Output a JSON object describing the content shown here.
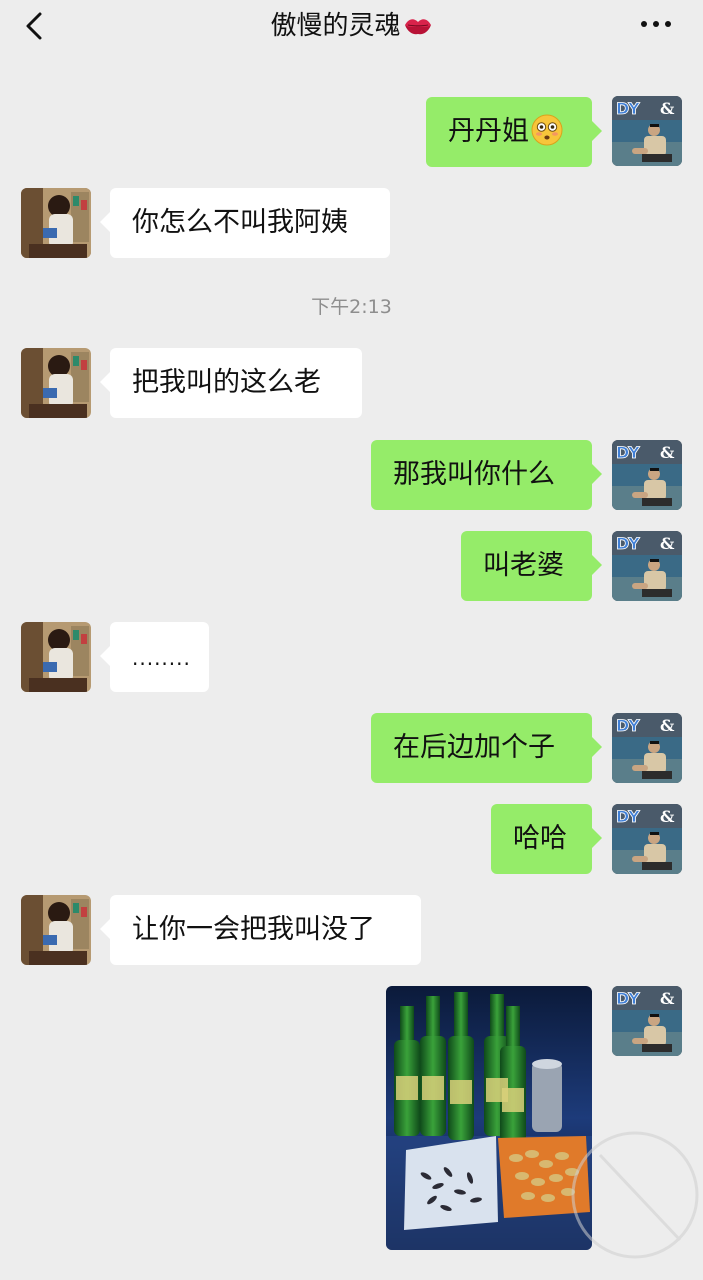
{
  "header": {
    "title": "傲慢的灵魂",
    "title_emoji": "lips-icon",
    "back_icon": "chevron-left-icon",
    "more_icon": "ellipsis-icon"
  },
  "timestamp": "下午2:13",
  "messages": [
    {
      "side": "out",
      "text": "丹丹姐",
      "emoji": "flushed-face-emoji"
    },
    {
      "side": "in",
      "text": "你怎么不叫我阿姨"
    },
    {
      "side": "in",
      "text": "把我叫的这么老"
    },
    {
      "side": "out",
      "text": "那我叫你什么"
    },
    {
      "side": "out",
      "text": "叫老婆"
    },
    {
      "side": "in",
      "text": "........"
    },
    {
      "side": "out",
      "text": "在后边加个子"
    },
    {
      "side": "out",
      "text": "哈哈"
    },
    {
      "side": "in",
      "text": "让你一会把我叫没了"
    },
    {
      "side": "out",
      "type": "image",
      "content": "beer-bottles-snacks-photo"
    }
  ],
  "avatars": {
    "self_text": "DY &"
  },
  "colors": {
    "background": "#ededed",
    "outgoing_bubble": "#95ec69",
    "incoming_bubble": "#ffffff"
  }
}
